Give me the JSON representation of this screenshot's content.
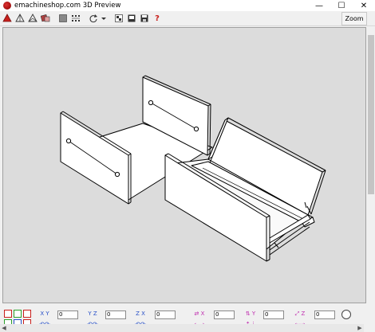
{
  "window": {
    "title": "emachineshop.com 3D Preview",
    "minimize_glyph": "—",
    "maximize_glyph": "☐",
    "close_glyph": "✕"
  },
  "toolbar": {
    "icons": [
      "solid-view-icon",
      "wireframe-icon",
      "perspective-icon",
      "render-icon",
      "shade-icon",
      "grid-icon",
      "rotate-icon",
      "dropdown-icon",
      "light-icon",
      "background-icon",
      "save-icon",
      "help-icon"
    ],
    "help_label": "?",
    "zoom_label": "Zoom"
  },
  "bottom": {
    "rotate_fields": [
      "0",
      "0",
      "0"
    ],
    "move_fields": [
      "0",
      "0",
      "0"
    ],
    "axis_labels": {
      "xy_x": "X",
      "xy_y": "Y",
      "yz_y": "Y",
      "yz_z": "Z",
      "zx_z": "Z",
      "zx_x": "X",
      "x2": "X",
      "y2": "Y",
      "z2": "Z"
    }
  },
  "colors": {
    "viewport_bg": "#dcdcdc",
    "part_face": "#ffffff",
    "edge": "#000000",
    "toolbar_red": "#c8201c",
    "bottom_magenta": "#c030b0",
    "bottom_blue": "#2850c8"
  }
}
